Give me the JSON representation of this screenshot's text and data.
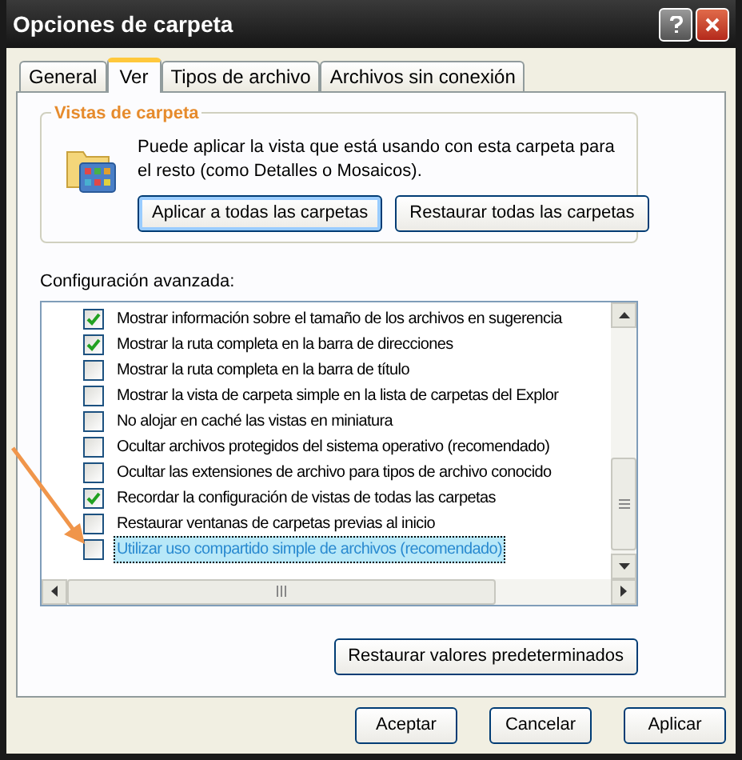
{
  "window": {
    "title": "Opciones de carpeta"
  },
  "tabs": [
    {
      "label": "General",
      "selected": false
    },
    {
      "label": "Ver",
      "selected": true
    },
    {
      "label": "Tipos de archivo",
      "selected": false
    },
    {
      "label": "Archivos sin conexión",
      "selected": false
    }
  ],
  "folder_views": {
    "title": "Vistas de carpeta",
    "description": "Puede aplicar la vista que está usando con esta carpeta para el resto (como Detalles o Mosaicos).",
    "buttons": [
      "Aplicar a todas las carpetas",
      "Restaurar todas las carpetas"
    ]
  },
  "advanced": {
    "label": "Configuración avanzada:",
    "items": [
      {
        "label": "Mostrar información sobre el tamaño de los archivos en sugerencia",
        "checked": true,
        "selected": false
      },
      {
        "label": "Mostrar la ruta completa en la barra de direcciones",
        "checked": true,
        "selected": false
      },
      {
        "label": "Mostrar la ruta completa en la barra de título",
        "checked": false,
        "selected": false
      },
      {
        "label": "Mostrar la vista de carpeta simple en la lista de carpetas del Explor",
        "checked": false,
        "selected": false
      },
      {
        "label": "No alojar en caché las vistas en miniatura",
        "checked": false,
        "selected": false
      },
      {
        "label": "Ocultar archivos protegidos del sistema operativo (recomendado)",
        "checked": false,
        "selected": false
      },
      {
        "label": "Ocultar las extensiones de archivo para tipos de archivo conocido",
        "checked": false,
        "selected": false
      },
      {
        "label": "Recordar la configuración de vistas de todas las carpetas",
        "checked": true,
        "selected": false
      },
      {
        "label": "Restaurar ventanas de carpetas previas al inicio",
        "checked": false,
        "selected": false
      },
      {
        "label": "Utilizar uso compartido simple de archivos (recomendado)",
        "checked": false,
        "selected": true
      }
    ],
    "restore_button": "Restaurar valores predeterminados"
  },
  "buttons": [
    "Aceptar",
    "Cancelar",
    "Aplicar"
  ]
}
